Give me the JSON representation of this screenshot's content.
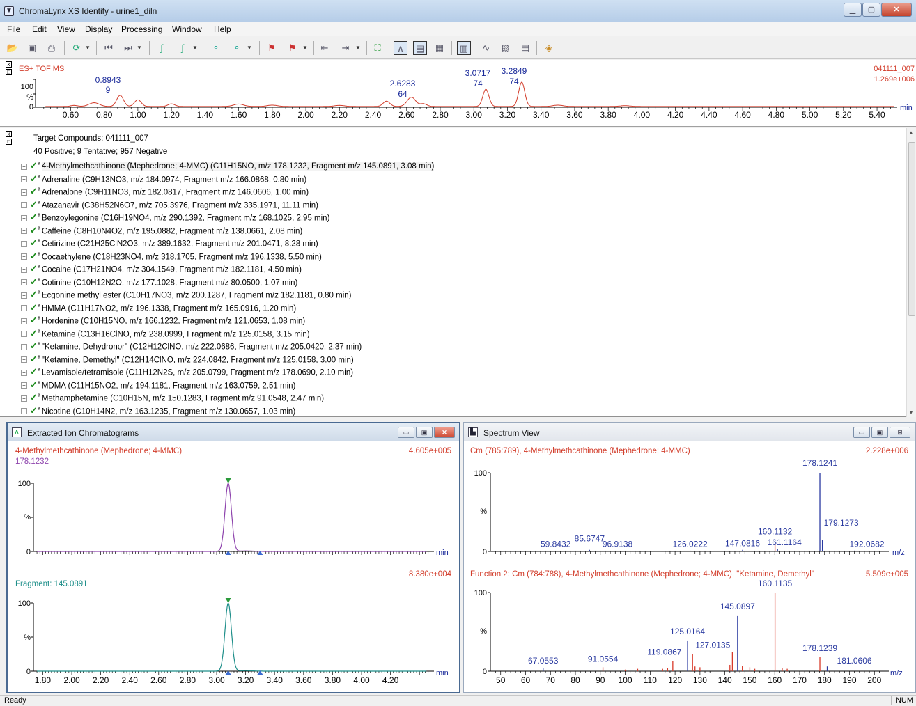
{
  "window": {
    "title": "ChromaLynx XS Identify - urine1_diln"
  },
  "menu": [
    "File",
    "Edit",
    "View",
    "Display",
    "Processing",
    "Window",
    "Help"
  ],
  "top_chrom": {
    "mode_label": "ES+ TOF MS",
    "sample_id": "041111_007",
    "intensity": "1.269e+006",
    "y_label_100": "100",
    "y_label_pct": "%",
    "y_label_0": "0",
    "x_unit": "min",
    "x_ticks": [
      "0.60",
      "0.80",
      "1.00",
      "1.20",
      "1.40",
      "1.60",
      "1.80",
      "2.00",
      "2.20",
      "2.40",
      "2.60",
      "2.80",
      "3.00",
      "3.20",
      "3.40",
      "3.60",
      "3.80",
      "4.00",
      "4.20",
      "4.40",
      "4.60",
      "4.80",
      "5.00",
      "5.20",
      "5.40"
    ],
    "peak_labels": [
      {
        "rt": "0.8943",
        "n": "9"
      },
      {
        "rt": "2.6283",
        "n": "64"
      },
      {
        "rt": "3.0717",
        "n": "74"
      },
      {
        "rt": "3.2849",
        "n": "74"
      }
    ]
  },
  "tree": {
    "header": "Target Compounds: 041111_007",
    "summary": "40 Positive; 9 Tentative; 957 Negative",
    "items": [
      "4-Methylmethcathinone (Mephedrone; 4-MMC) (C11H15NO, m/z 178.1232, Fragment m/z 145.0891, 3.08 min)",
      "Adrenaline (C9H13NO3, m/z 184.0974, Fragment m/z 166.0868, 0.80 min)",
      "Adrenalone (C9H11NO3, m/z 182.0817, Fragment m/z 146.0606, 1.00 min)",
      "Atazanavir (C38H52N6O7, m/z 705.3976, Fragment m/z 335.1971, 11.11 min)",
      "Benzoylegonine (C16H19NO4, m/z 290.1392, Fragment m/z 168.1025, 2.95 min)",
      "Caffeine (C8H10N4O2, m/z 195.0882, Fragment m/z 138.0661, 2.08 min)",
      "Cetirizine (C21H25ClN2O3, m/z 389.1632, Fragment m/z 201.0471, 8.28 min)",
      "Cocaethylene (C18H23NO4, m/z 318.1705, Fragment m/z 196.1338, 5.50 min)",
      "Cocaine (C17H21NO4, m/z 304.1549, Fragment m/z 182.1181, 4.50 min)",
      "Cotinine (C10H12N2O, m/z 177.1028, Fragment m/z 80.0500, 1.07 min)",
      "Ecgonine methyl ester (C10H17NO3, m/z 200.1287, Fragment m/z 182.1181, 0.80 min)",
      "HMMA (C11H17NO2, m/z 196.1338, Fragment m/z 165.0916, 1.20 min)",
      "Hordenine (C10H15NO, m/z 166.1232, Fragment m/z 121.0653, 1.08 min)",
      "Ketamine (C13H16ClNO, m/z 238.0999, Fragment m/z 125.0158, 3.15 min)",
      "\"Ketamine, Dehydronor\" (C12H12ClNO, m/z 222.0686, Fragment m/z 205.0420, 2.37 min)",
      "\"Ketamine, Demethyl\" (C12H14ClNO, m/z 224.0842, Fragment m/z 125.0158, 3.00 min)",
      "Levamisole/tetramisole (C11H12N2S, m/z 205.0799, Fragment m/z 178.0690, 2.10 min)",
      "MDMA (C11H15NO2, m/z 194.1181, Fragment m/z 163.0759, 2.51 min)",
      "Methamphetamine (C10H15N, m/z 150.1283, Fragment m/z 91.0548, 2.47 min)",
      "Nicotine (C10H14N2, m/z 163.1235, Fragment m/z 130.0657, 1.03 min)"
    ]
  },
  "xic": {
    "title": "Extracted Ion Chromatograms",
    "trace1": {
      "name": "4-Methylmethcathinone (Mephedrone; 4-MMC)",
      "mz": "178.1232",
      "intensity": "4.605e+005",
      "color": "#8e44ad"
    },
    "trace2": {
      "name": "Fragment: 145.0891",
      "intensity": "8.380e+004",
      "color": "#1f8f8a"
    },
    "y100": "100",
    "ypct": "%",
    "y0": "0",
    "x_unit": "min",
    "x_ticks": [
      "1.80",
      "2.00",
      "2.20",
      "2.40",
      "2.60",
      "2.80",
      "3.00",
      "3.20",
      "3.40",
      "3.60",
      "3.80",
      "4.00",
      "4.20"
    ]
  },
  "spectrum": {
    "title": "Spectrum View",
    "upper": {
      "desc": "Cm (785:789), 4-Methylmethcathinone (Mephedrone; 4-MMC)",
      "intensity": "2.228e+006",
      "labels": [
        "178.1241",
        "179.1273",
        "160.1132",
        "161.1164",
        "59.8432",
        "85.6747",
        "96.9138",
        "126.0222",
        "147.0816",
        "192.0682"
      ],
      "x_unit": "m/z"
    },
    "lower": {
      "desc": "Function 2: Cm (784:788), 4-Methylmethcathinone (Mephedrone; 4-MMC), \"Ketamine, Demethyl\"",
      "intensity": "5.509e+005",
      "labels": [
        "160.1135",
        "145.0897",
        "125.0164",
        "127.0135",
        "119.0867",
        "91.0554",
        "67.0553",
        "178.1239",
        "181.0606"
      ],
      "x_unit": "m/z",
      "x_ticks": [
        "50",
        "60",
        "70",
        "80",
        "90",
        "100",
        "110",
        "120",
        "130",
        "140",
        "150",
        "160",
        "170",
        "180",
        "190",
        "200"
      ]
    },
    "y100": "100",
    "ypct": "%",
    "y0": "0"
  },
  "status": {
    "left": "Ready",
    "right": "NUM"
  },
  "colors": {
    "trace_red": "#d23c2a",
    "axis_blue": "#1a2a9a",
    "spectrum_blue": "#2a3aa0",
    "spectrum_red": "#d83a2a"
  }
}
